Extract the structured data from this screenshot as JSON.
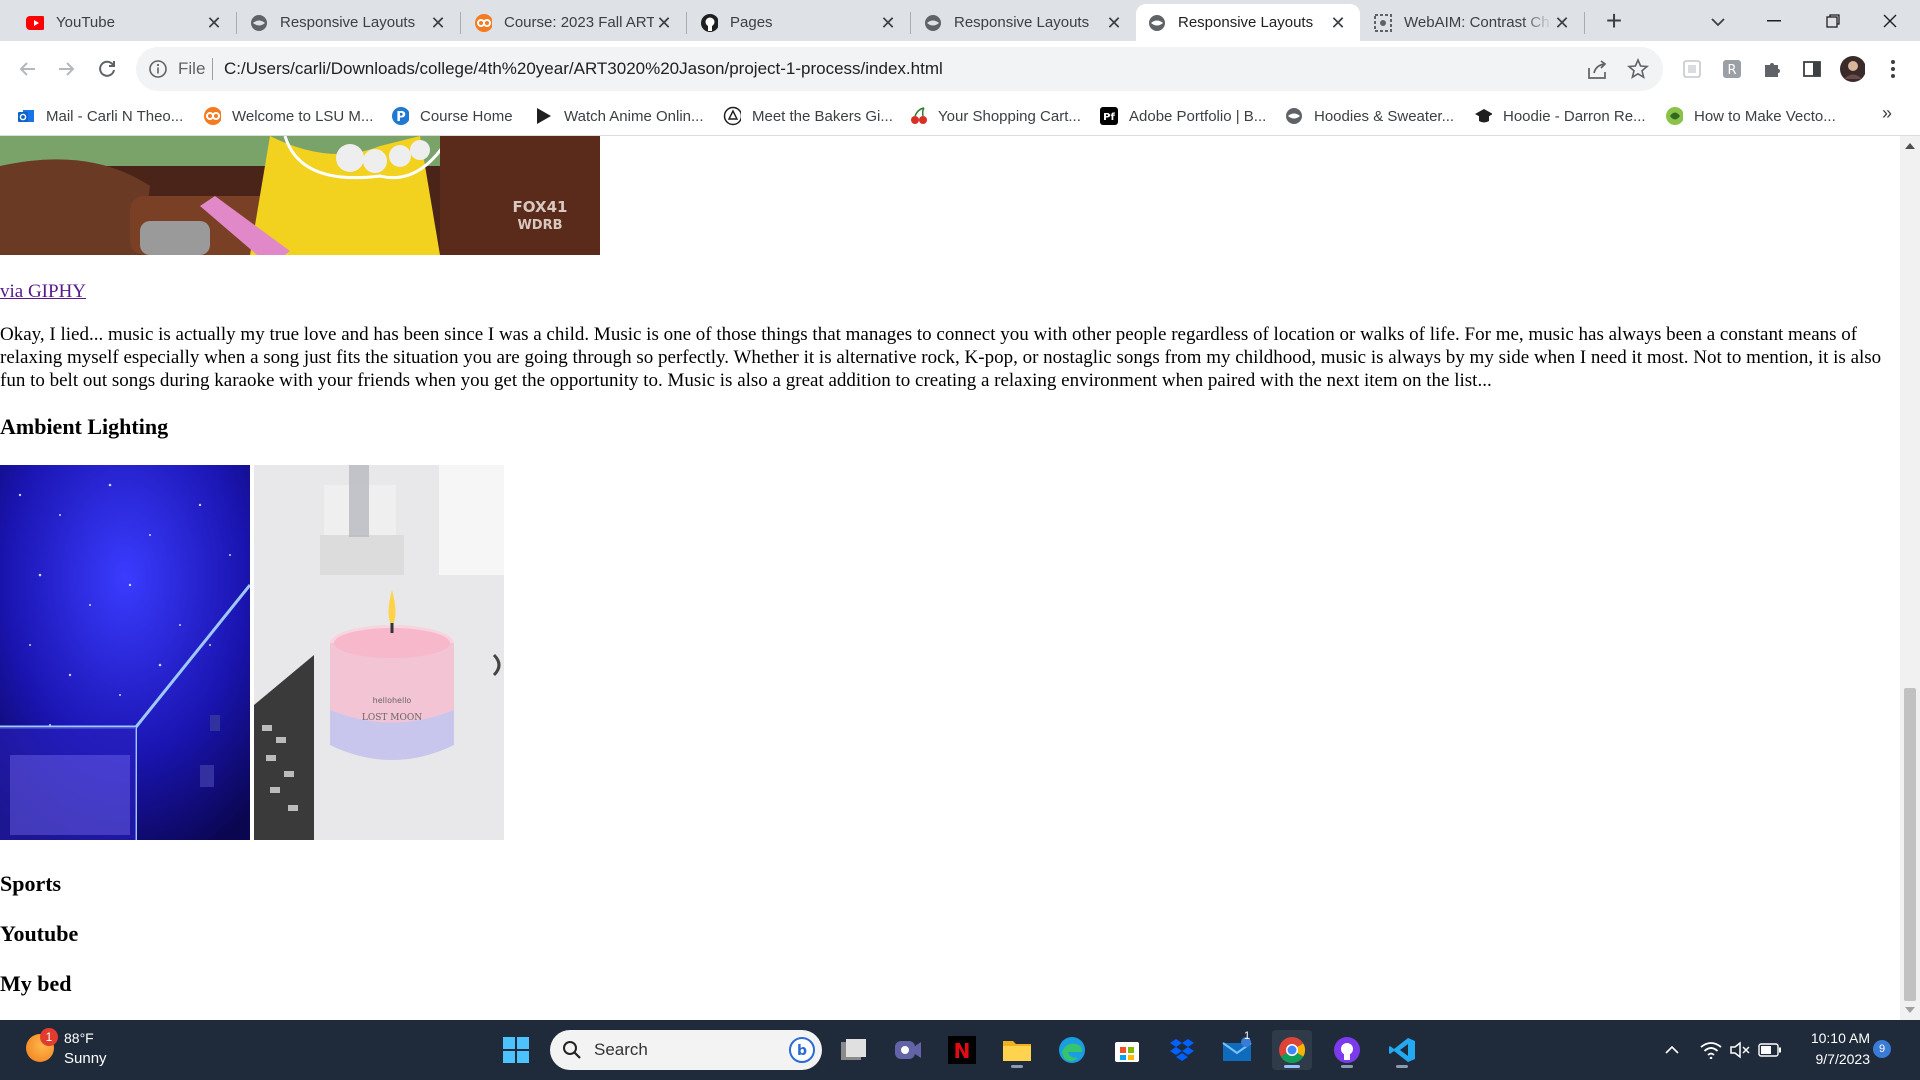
{
  "browser": {
    "tabs": [
      {
        "label": "YouTube",
        "icon": "youtube-icon"
      },
      {
        "label": "Responsive Layouts",
        "icon": "globe-icon"
      },
      {
        "label": "Course: 2023 Fall ART",
        "icon": "moodle-icon"
      },
      {
        "label": "Pages",
        "icon": "github-icon"
      },
      {
        "label": "Responsive Layouts",
        "icon": "globe-icon"
      },
      {
        "label": "Responsive Layouts",
        "icon": "globe-icon",
        "active": true
      },
      {
        "label": "WebAIM: Contrast Ch",
        "icon": "webaim-icon"
      }
    ],
    "address": {
      "scheme_label": "File",
      "url": "C:/Users/carli/Downloads/college/4th%20year/ART3020%20Jason/project-1-process/index.html"
    },
    "bookmarks": [
      {
        "label": "Mail - Carli N Theo...",
        "icon": "outlook-icon"
      },
      {
        "label": "Welcome to LSU M...",
        "icon": "moodle-icon"
      },
      {
        "label": "Course Home",
        "icon": "pearson-icon"
      },
      {
        "label": "Watch Anime Onlin...",
        "icon": "play-icon"
      },
      {
        "label": "Meet the Bakers Gi...",
        "icon": "chef-icon"
      },
      {
        "label": "Your Shopping Cart...",
        "icon": "cherry-icon"
      },
      {
        "label": "Adobe Portfolio | B...",
        "icon": "adobe-portfolio-icon"
      },
      {
        "label": "Hoodies & Sweater...",
        "icon": "globe-icon"
      },
      {
        "label": "Hoodie - Darron Re...",
        "icon": "grad-cap-icon"
      },
      {
        "label": "How to Make Vecto...",
        "icon": "vector-icon"
      }
    ],
    "more_bookmarks": "»"
  },
  "page": {
    "gif_watermark": [
      "FOX41",
      "WDRB"
    ],
    "giphy_link": "via GIPHY",
    "paragraph": "Okay, I lied... music is actually my true love and has been since I was a child. Music is one of those things that manages to connect you with other people regardless of location or walks of life. For me, music has always been a constant means of relaxing myself especially when a song just fits the situation you are going through so perfectly. Whether it is alternative rock, K-pop, or nostaglic songs from my childhood, music is always by my side when I need it most. Not to mention, it is also fun to belt out songs during karaoke with your friends when you get the opportunity to. Music is also a great addition to creating a relaxing environment when paired with the next item on the list...",
    "heading_ambient": "Ambient Lighting",
    "candle_label": [
      "hellohello",
      "LOST MOON"
    ],
    "heading_sports": "Sports",
    "heading_youtube": "Youtube",
    "heading_bed": "My bed"
  },
  "taskbar": {
    "weather_badge": "1",
    "temperature": "88°F",
    "condition": "Sunny",
    "search_placeholder": "Search",
    "time": "10:10 AM",
    "date": "9/7/2023",
    "notification_count": "9",
    "mail_badge": "1",
    "apps": [
      "start-icon",
      "search",
      "task-view-icon",
      "teams-icon",
      "netflix-icon",
      "file-explorer-icon",
      "edge-icon",
      "store-icon",
      "dropbox-icon",
      "mail-icon",
      "chrome-icon",
      "github-desktop-icon",
      "vscode-icon"
    ]
  }
}
